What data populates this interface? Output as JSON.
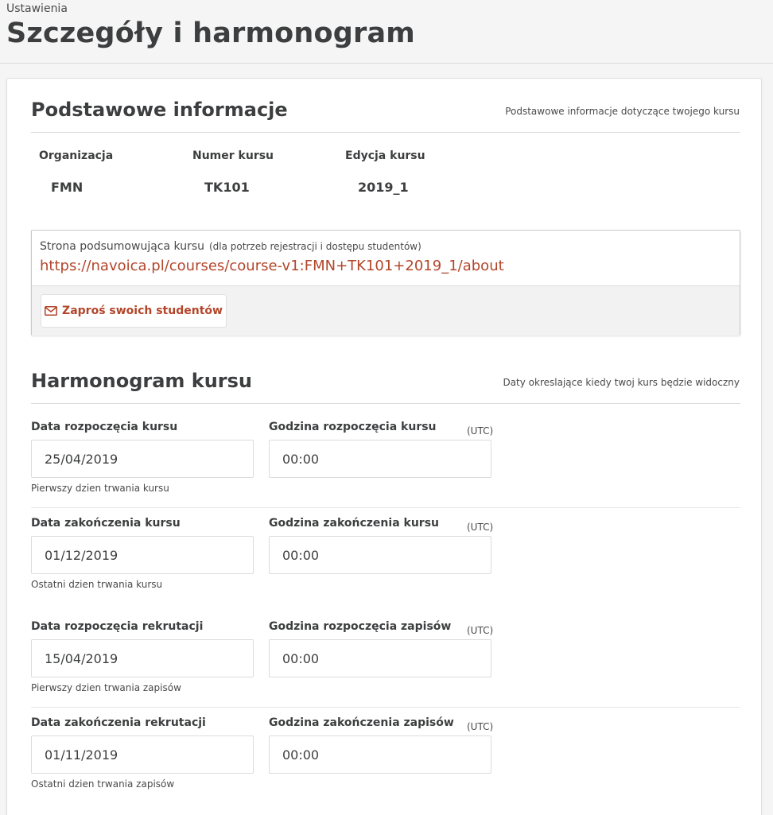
{
  "header": {
    "subtitle": "Ustawienia",
    "title": "Szczegóły i harmonogram"
  },
  "basic_info": {
    "title": "Podstawowe informacje",
    "description": "Podstawowe informacje dotyczące twojego kursu",
    "organization_label": "Organizacja",
    "organization_value": "FMN",
    "course_number_label": "Numer kursu",
    "course_number_value": "TK101",
    "course_run_label": "Edycja kursu",
    "course_run_value": "2019_1",
    "summary_label": "Strona podsumowująca kursu",
    "summary_note": "(dla potrzeb rejestracji i dostępu studentów)",
    "summary_url": "https://navoica.pl/courses/course-v1:FMN+TK101+2019_1/about",
    "invite_button": "Zaproś swoich studentów",
    "invite_icon": "envelope-icon",
    "link_color": "#b2452a"
  },
  "schedule": {
    "title": "Harmonogram kursu",
    "description": "Daty okreslające kiedy twoj kurs będzie widoczny",
    "utc": "(UTC)",
    "rows": [
      {
        "date_label": "Data rozpoczęcia kursu",
        "date_value": "25/04/2019",
        "time_label": "Godzina rozpoczęcia kursu",
        "time_value": "00:00",
        "help": "Pierwszy dzien trwania kursu"
      },
      {
        "date_label": "Data zakończenia kursu",
        "date_value": "01/12/2019",
        "time_label": "Godzina zakończenia kursu",
        "time_value": "00:00",
        "help": "Ostatni dzien trwania kursu"
      },
      {
        "date_label": "Data rozpoczęcia rekrutacji",
        "date_value": "15/04/2019",
        "time_label": "Godzina rozpoczęcia zapisów",
        "time_value": "00:00",
        "help": "Pierwszy dzien trwania zapisów"
      },
      {
        "date_label": "Data zakończenia rekrutacji",
        "date_value": "01/11/2019",
        "time_label": "Godzina zakończenia zapisów",
        "time_value": "00:00",
        "help": "Ostatni dzien trwania zapisów"
      }
    ]
  }
}
